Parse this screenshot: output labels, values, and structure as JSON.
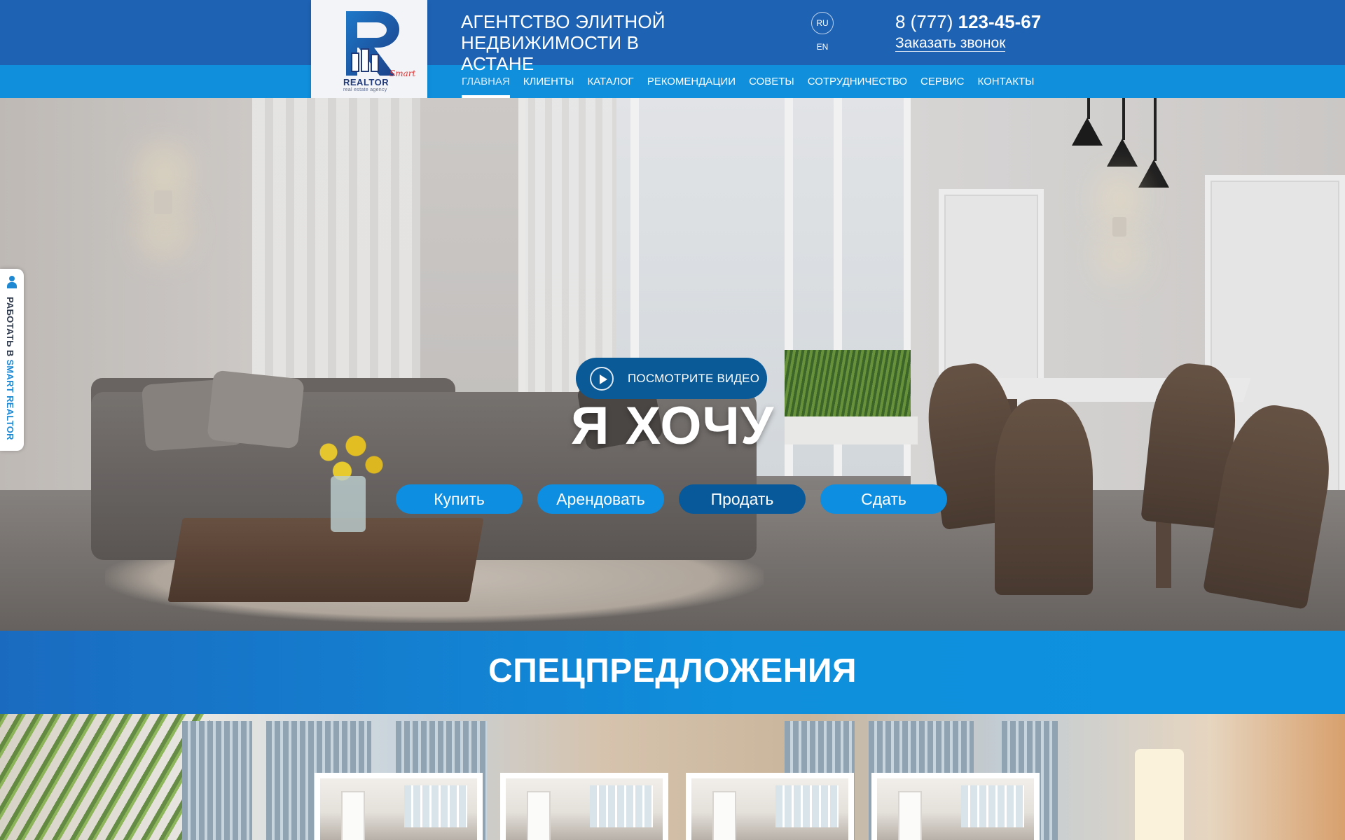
{
  "header": {
    "brand_title_line1": "АГЕНТСТВО ЭЛИТНОЙ",
    "brand_title_line2": "НЕДВИЖИМОСТИ В АСТАНЕ",
    "logo": {
      "word_smart": "Smart",
      "word_realtor": "REALTOR",
      "tagline": "real estate agency",
      "letter": "R"
    },
    "languages": [
      "RU",
      "EN"
    ],
    "active_language": "RU",
    "phone_prefix": "8 (777)",
    "phone_number": "123-45-67",
    "callback_label": "Заказать звонок"
  },
  "nav": {
    "items": [
      {
        "label": "ГЛАВНАЯ",
        "active": true
      },
      {
        "label": "КЛИЕНТЫ"
      },
      {
        "label": "КАТАЛОГ"
      },
      {
        "label": "РЕКОМЕНДАЦИИ"
      },
      {
        "label": "СОВЕТЫ"
      },
      {
        "label": "СОТРУДНИЧЕСТВО"
      },
      {
        "label": "СЕРВИС"
      },
      {
        "label": "КОНТАКТЫ"
      }
    ]
  },
  "hero": {
    "video_button_label": "ПОСМОТРИТЕ ВИДЕО",
    "headline": "Я ХОЧУ",
    "actions": [
      "Купить",
      "Арендовать",
      "Продать",
      "Сдать"
    ],
    "highlighted_action": "Продать"
  },
  "side_tab": {
    "label_prefix": "РАБОТАТЬ В ",
    "label_brand": "SMART REALTOR"
  },
  "offers": {
    "title": "СПЕЦПРЕДЛОЖЕНИЯ",
    "card_count": 4
  },
  "colors": {
    "topbar": "#1e62b4",
    "navbar": "#0f8fdc",
    "button_blue": "#0e8ee0",
    "button_dark": "#08599a",
    "logo_navy": "#213a7a",
    "logo_red": "#d83a3a"
  }
}
